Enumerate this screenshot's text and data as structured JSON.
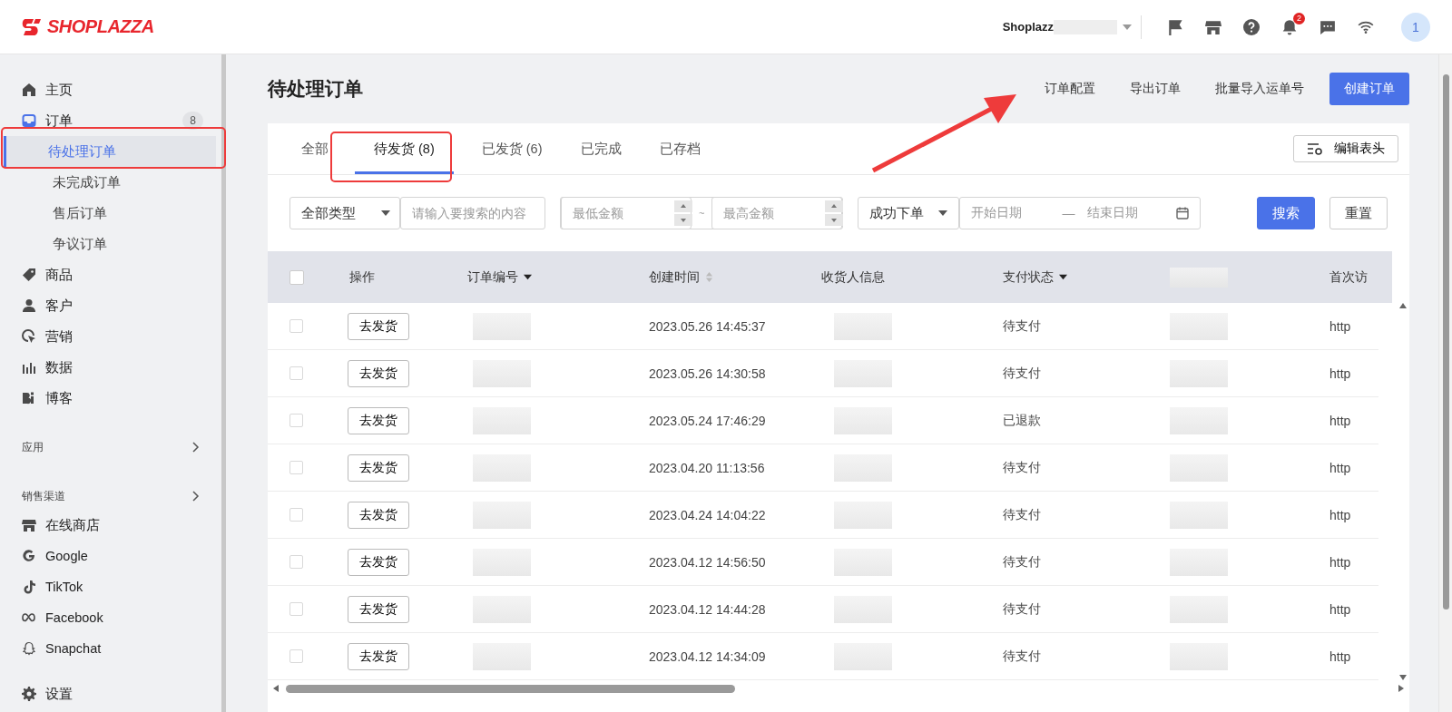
{
  "brand": {
    "name": "SHOPLAZZA"
  },
  "topbar": {
    "store_name": "Shoplazz",
    "notification_count": "2",
    "avatar": "1"
  },
  "sidebar": {
    "items": [
      {
        "label": "主页",
        "selected": false
      },
      {
        "label": "订单",
        "selected": false,
        "badge": "8",
        "children": [
          {
            "label": "待处理订单",
            "selected": true
          },
          {
            "label": "未完成订单",
            "selected": false
          },
          {
            "label": "售后订单",
            "selected": false
          },
          {
            "label": "争议订单",
            "selected": false
          }
        ]
      },
      {
        "label": "商品",
        "selected": false
      },
      {
        "label": "客户",
        "selected": false
      },
      {
        "label": "营销",
        "selected": false
      },
      {
        "label": "数据",
        "selected": false
      },
      {
        "label": "博客",
        "selected": false
      }
    ],
    "sections": [
      {
        "label": "应用"
      },
      {
        "label": "销售渠道",
        "items": [
          {
            "label": "在线商店",
            "selected": false
          },
          {
            "label": "Google",
            "selected": false
          },
          {
            "label": "TikTok",
            "selected": false
          },
          {
            "label": "Facebook",
            "selected": false
          },
          {
            "label": "Snapchat",
            "selected": false
          }
        ]
      }
    ],
    "footer": {
      "label": "设置",
      "selected": false
    }
  },
  "page": {
    "title": "待处理订单",
    "actions": [
      "订单配置",
      "导出订单",
      "批量导入运单号"
    ],
    "primary_action": "创建订单"
  },
  "tabs": [
    {
      "label": "全部",
      "selected": false
    },
    {
      "label": "待发货",
      "count": "(8)",
      "selected": true
    },
    {
      "label": "已发货",
      "count": "(6)",
      "selected": false
    },
    {
      "label": "已完成",
      "selected": false
    },
    {
      "label": "已存档",
      "selected": false
    }
  ],
  "edit_columns_button": "编辑表头",
  "filters": {
    "type_select": "全部类型",
    "search_placeholder": "请输入要搜索的内容",
    "min_placeholder": "最低金额",
    "range_separator": "~",
    "max_placeholder": "最高金额",
    "status_select": "成功下单",
    "start_placeholder": "开始日期",
    "date_separator": "—",
    "end_placeholder": "结束日期",
    "search_button": "搜索",
    "reset_button": "重置"
  },
  "table": {
    "select_all_checked": false,
    "columns": [
      {
        "label": "操作",
        "kind": "plain"
      },
      {
        "label": "订单编号",
        "kind": "filter"
      },
      {
        "label": "创建时间",
        "kind": "sortable"
      },
      {
        "label": "收货人信息",
        "kind": "plain"
      },
      {
        "label": "支付状态",
        "kind": "filter"
      },
      {
        "label": "首次访",
        "kind": "plain"
      }
    ],
    "rows": [
      {
        "checked": false,
        "action": "去发货",
        "created": "2023.05.26 14:45:37",
        "payment_status": "待支付",
        "column_7": "http"
      },
      {
        "checked": false,
        "action": "去发货",
        "created": "2023.05.26 14:30:58",
        "payment_status": "待支付",
        "column_7": "http"
      },
      {
        "checked": false,
        "action": "去发货",
        "created": "2023.05.24 17:46:29",
        "payment_status": "已退款",
        "column_7": "http"
      },
      {
        "checked": false,
        "action": "去发货",
        "created": "2023.04.20 11:13:56",
        "payment_status": "待支付",
        "column_7": "http"
      },
      {
        "checked": false,
        "action": "去发货",
        "created": "2023.04.24 14:04:22",
        "payment_status": "待支付",
        "column_7": "http"
      },
      {
        "checked": false,
        "action": "去发货",
        "created": "2023.04.12 14:56:50",
        "payment_status": "待支付",
        "column_7": "http"
      },
      {
        "checked": false,
        "action": "去发货",
        "created": "2023.04.12 14:44:28",
        "payment_status": "待支付",
        "column_7": "http"
      },
      {
        "checked": false,
        "action": "去发货",
        "created": "2023.04.12 14:34:09",
        "payment_status": "待支付",
        "column_7": "http"
      }
    ]
  }
}
